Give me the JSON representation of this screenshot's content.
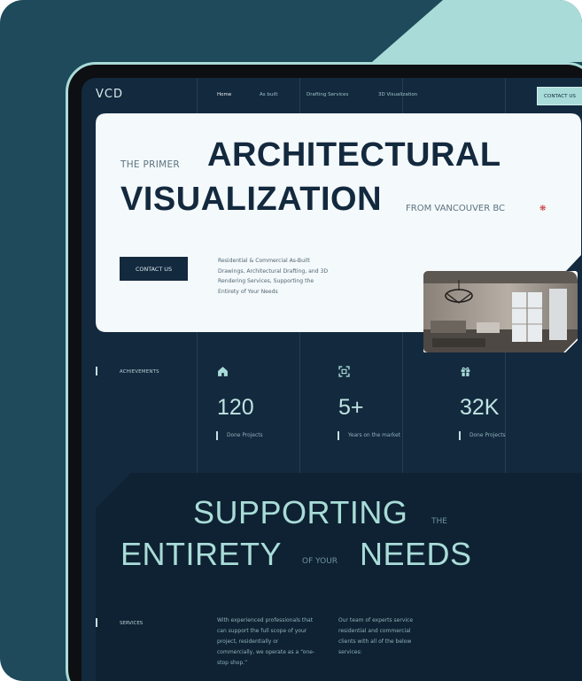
{
  "nav": {
    "logo": "VCD",
    "items": [
      "Home",
      "As built",
      "Drafting Services",
      "3D Visualization"
    ],
    "active": "Home",
    "cta": "CONTACT US"
  },
  "hero": {
    "primer": "THE PRIMER",
    "title_line1": "ARCHITECTURAL",
    "title_line2": "VISUALIZATION",
    "location": "FROM VANCOUVER BC",
    "cta": "CONTACT US",
    "description": "Residential & Commercial As-Built Drawings, Architectural Drafting, and 3D Rendering Services, Supporting the Entirety of Your Needs"
  },
  "achievements": {
    "label": "ACHIEVEMENTS",
    "stats": [
      {
        "icon": "home-icon",
        "value": "120",
        "label": "Done Projects"
      },
      {
        "icon": "scan-icon",
        "value": "5+",
        "label": "Years on the market"
      },
      {
        "icon": "gift-icon",
        "value": "32K",
        "label": "Done Projects"
      }
    ]
  },
  "supporting": {
    "word1": "SUPPORTING",
    "small1": "THE",
    "word2": "ENTIRETY",
    "small2": "OF YOUR",
    "word3": "NEEDS"
  },
  "services": {
    "label": "SERVICES",
    "para1": "With experienced professionals that can support the full scope of your project, residentially or commercially, we operate as a “one-stop shop.”",
    "para2": "Our team of experts service residential and commercial clients with all of the below services:"
  },
  "colors": {
    "background": "#1e4a5b",
    "accent": "#a9dcd8",
    "screen": "#13293e",
    "hero_card": "#f4f9fb",
    "dark_section": "#0e2233"
  }
}
